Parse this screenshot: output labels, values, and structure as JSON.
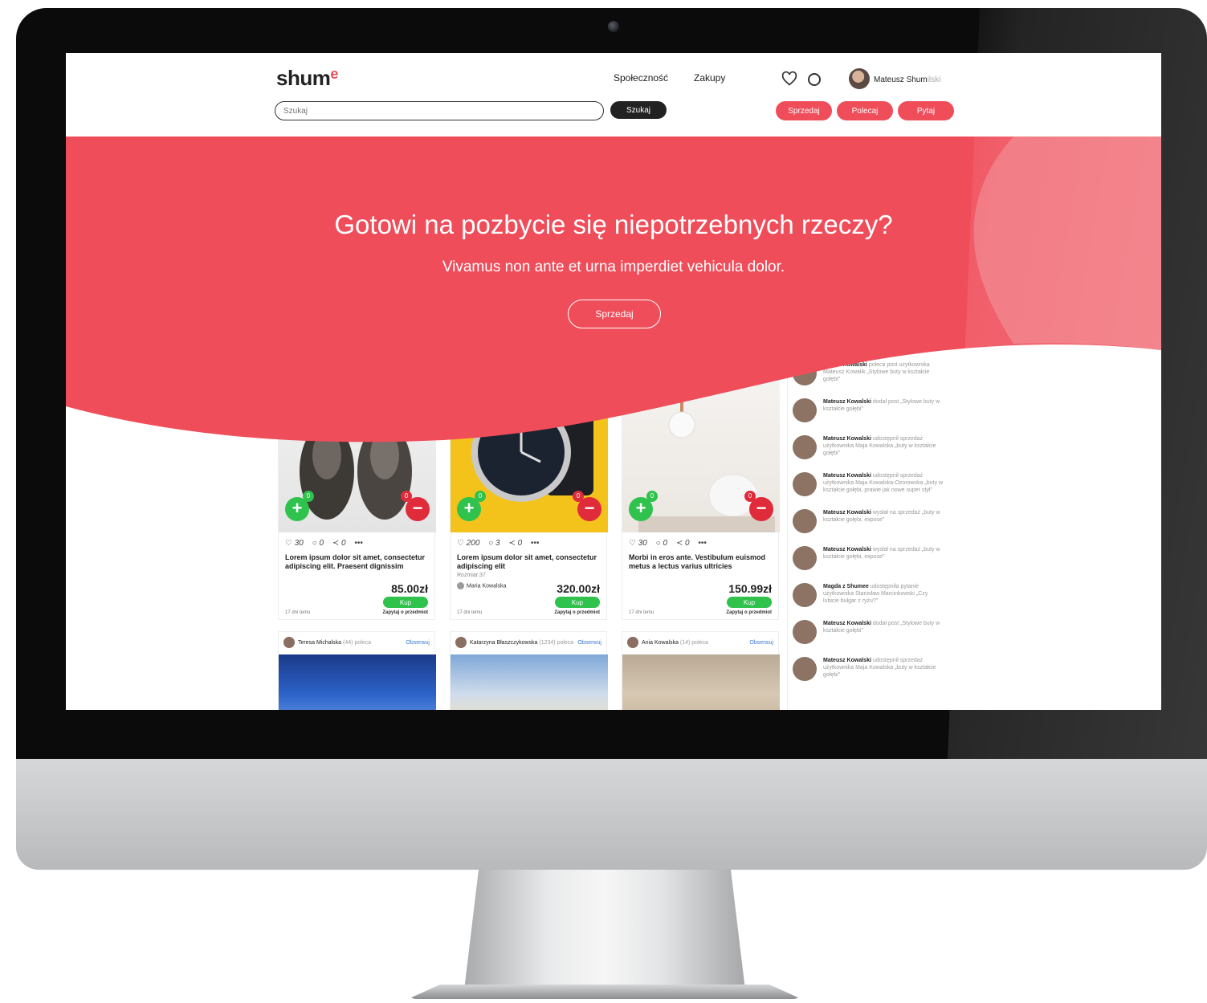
{
  "header": {
    "logo": "shum",
    "logo_accent": "e",
    "search_placeholder": "Szukaj",
    "search_button": "Szukaj",
    "nav": [
      "Społeczność",
      "Zakupy"
    ],
    "user_name": "Mateusz Shum",
    "user_name_faded": "ilski",
    "pills": [
      "Sprzedaj",
      "Polecaj",
      "Pytaj"
    ]
  },
  "hero": {
    "title": "Gotowi na pozbycie się niepotrzebnych rzeczy?",
    "subtitle": "Vivamus non ante et urna imperdiet vehicula dolor.",
    "button": "Sprzedaj"
  },
  "products": [
    {
      "likes": "30",
      "comments": "0",
      "shares": "0",
      "title": "Lorem ipsum dolor sit amet, consectetur adipiscing elit. Praesent dignissim",
      "meta": "",
      "seller": "",
      "price": "85.00zł",
      "buy": "Kup",
      "time": "17 dni temu",
      "ask": "Zapytaj o przedmiot"
    },
    {
      "likes": "200",
      "comments": "3",
      "shares": "0",
      "title": "Lorem ipsum dolor sit amet, consectetur adipiscing elit",
      "meta": "Rozmiar:37",
      "seller": "Maria Kowalska",
      "price": "320.00zł",
      "buy": "Kup",
      "time": "17 dni temu",
      "ask": "Zapytaj o przedmiot"
    },
    {
      "likes": "30",
      "comments": "0",
      "shares": "0",
      "title": "Morbi in eros ante. Vestibulum euismod metus a lectus varius ultricies",
      "meta": "",
      "seller": "",
      "price": "150.99zł",
      "buy": "Kup",
      "time": "17 dni temu",
      "ask": "Zapytaj o przedmiot"
    }
  ],
  "posts": [
    {
      "author": "Teresa Michalska",
      "count": "(44)",
      "role": "poleca",
      "follow": "Obserwuj"
    },
    {
      "author": "Katarzyna Błaszczykowska",
      "count": "(1234)",
      "role": "poleca",
      "follow": "Obserwuj"
    },
    {
      "author": "Ania Kowalska",
      "count": "(14)",
      "role": "poleca",
      "follow": "Obserwuj"
    }
  ],
  "feed": [
    {
      "name": "Marian Kowalski",
      "text": "poleca post użytkownika Mateusz Kowalik „Stylowe buty w kształcie gołębi\""
    },
    {
      "name": "Mateusz Kowalski",
      "text": "dodał post „Stylowe buty w kształcie gołębi\""
    },
    {
      "name": "Mateusz Kowalski",
      "text": "udostępnił sprzedaż użytkownika Maja Kowalska „buty w kształcie gołębi\""
    },
    {
      "name": "Mateusz Kowalski",
      "text": "udostępnił sprzedaż użytkownika Maja Kowalska-Ozorowska „buty w kształcie gołębi, prawie jak nowe super stył\""
    },
    {
      "name": "Mateusz Kowalski",
      "text": "wysłał na sprzedaż „buty w kształcie gołębi, expose\""
    },
    {
      "name": "Mateusz Kowalski",
      "text": "wysłał na sprzedaż „buty w kształcie gołębi, expose\""
    },
    {
      "name": "Magda z Shumee",
      "text": "udostępniła pytanie użytkownika Stanisław Marcinkowski „Czy lubicie bułgar z ryżu?\""
    },
    {
      "name": "Mateusz Kowalski",
      "text": "dodał post „Stylowe buty w kształcie gołębi\""
    },
    {
      "name": "Mateusz Kowalski",
      "text": "udostępnił sprzedaż użytkownika Maja Kowalska „buty w kształcie gołębi\""
    }
  ],
  "colors": {
    "brand_red": "#ef4d5a",
    "buy_green": "#2fc24d",
    "minus_red": "#e02b3a"
  }
}
